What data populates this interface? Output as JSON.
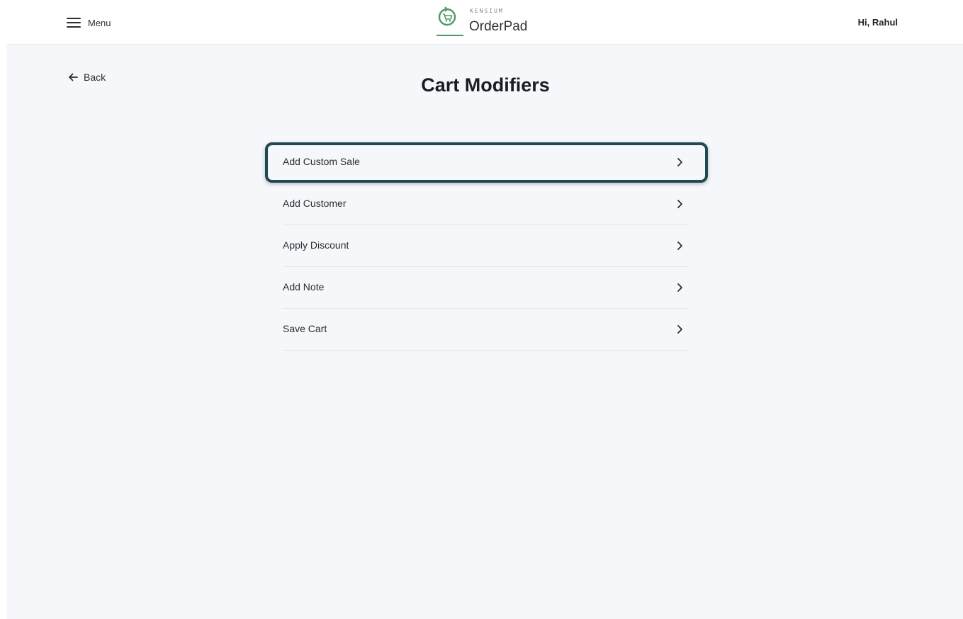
{
  "header": {
    "menu_label": "Menu",
    "logo_top_text": "KENSIUM",
    "logo_name": "OrderPad",
    "greeting": "Hi, Rahul",
    "brand_color": "#4c9a6a"
  },
  "nav": {
    "back_label": "Back"
  },
  "page": {
    "title": "Cart Modifiers"
  },
  "modifiers": {
    "items": [
      {
        "label": "Add Custom Sale",
        "highlighted": true
      },
      {
        "label": "Add Customer",
        "highlighted": false
      },
      {
        "label": "Apply Discount",
        "highlighted": false
      },
      {
        "label": "Add Note",
        "highlighted": false
      },
      {
        "label": "Save Cart",
        "highlighted": false
      }
    ],
    "highlight_color": "#1e4a50"
  }
}
